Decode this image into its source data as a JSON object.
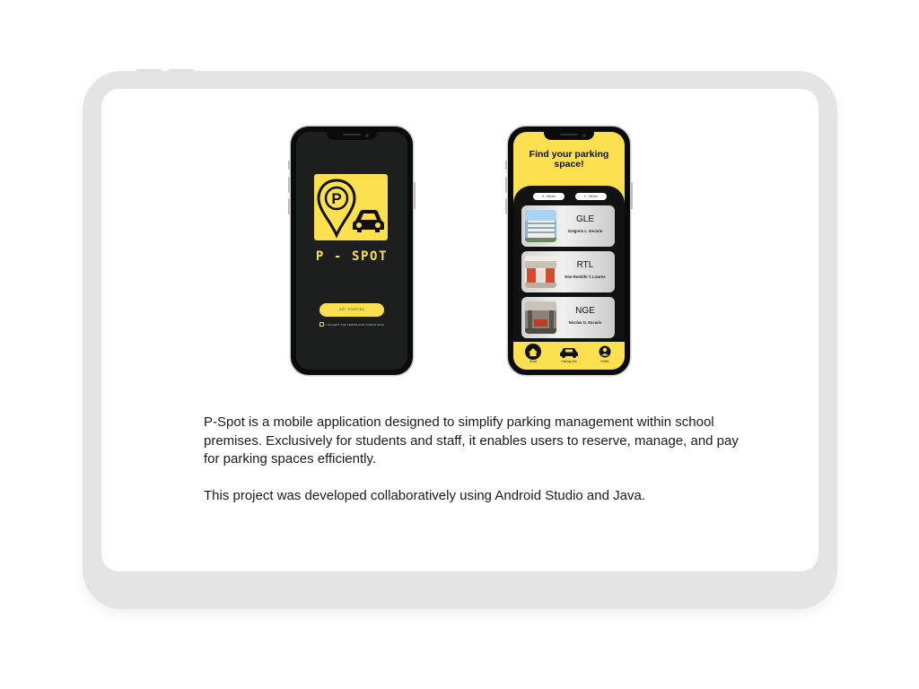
{
  "splash": {
    "app_name": "P - SPOT",
    "logo_letter": "P",
    "get_started": "GET STARTED",
    "terms": "I ACCEPT THE TERMS AND CONDITIONS"
  },
  "parking": {
    "title_line1": "Find your parking",
    "title_line2": "space!",
    "filters": [
      "4 - Wheel",
      "2 - Wheel"
    ],
    "locations": [
      {
        "code": "GLE",
        "name": "Gregorio L. Escario"
      },
      {
        "code": "RTL",
        "name": "Don Rodolfo T. Lizares"
      },
      {
        "code": "NGE",
        "name": "Nicolas G. Escario"
      }
    ],
    "nav": [
      "Home",
      "Parking Info",
      "Profile"
    ]
  },
  "description": {
    "paragraph1": "P-Spot is a mobile application designed to simplify parking management within school premises. Exclusively for students and staff, it enables users to reserve, manage, and pay for parking spaces efficiently.",
    "paragraph2": "This project was developed collaboratively using Android Studio and Java."
  },
  "colors": {
    "brand_yellow": "#fde04f",
    "splash_bg": "#1c1f1e",
    "list_dark": "#121212"
  },
  "icons": [
    "parking-pin-icon",
    "car-icon",
    "home-icon",
    "car-info-icon",
    "profile-icon"
  ]
}
